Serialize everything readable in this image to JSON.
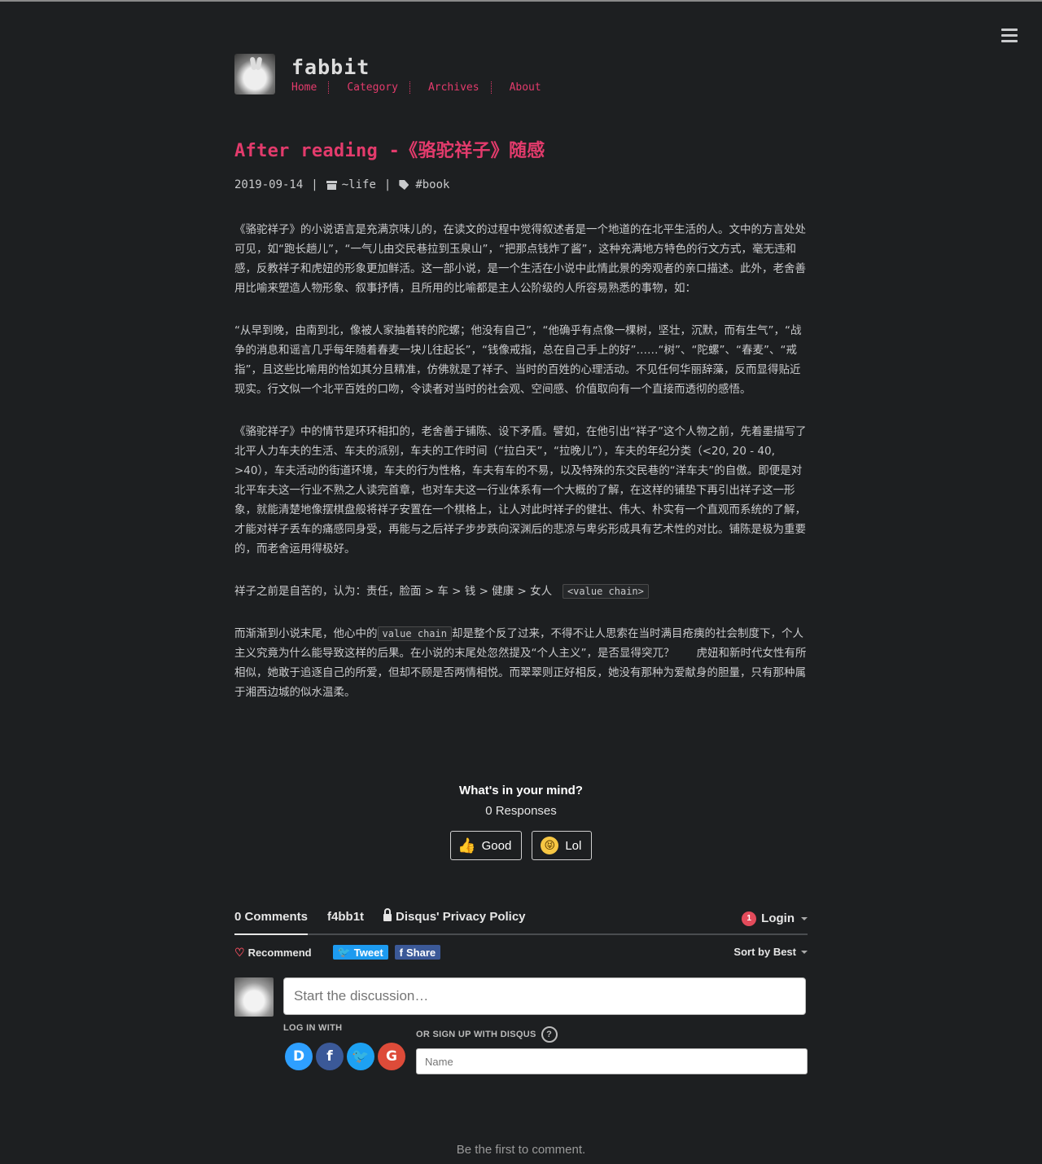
{
  "site": {
    "title": "fabbit",
    "nav": [
      "Home",
      "Category",
      "Archives",
      "About"
    ]
  },
  "post": {
    "title": "After reading -《骆驼祥子》随感",
    "date": "2019-09-14",
    "sep": "|",
    "category": "~life",
    "tag": "#book",
    "paragraphs": [
      "《骆驼祥子》的小说语言是充满京味儿的，在读文的过程中觉得叙述者是一个地道的在北平生活的人。文中的方言处处可见，如“跑长趟儿”，“一气儿由交民巷拉到玉泉山”，“把那点钱炸了酱”，这种充满地方特色的行文方式，毫无违和感，反教祥子和虎妞的形象更加鲜活。这一部小说，是一个生活在小说中此情此景的旁观者的亲口描述。此外，老舍善用比喻来塑造人物形象、叙事抒情，且所用的比喻都是主人公阶级的人所容易熟悉的事物，如：",
      "“从早到晚，由南到北，像被人家抽着转的陀螺；他没有自己”，“他确乎有点像一棵树，坚壮，沉默，而有生气”，“战争的消息和谣言几乎每年随着春麦一块儿往起长”，“钱像戒指，总在自己手上的好”……“树”、“陀螺”、“春麦”、“戒指”，且这些比喻用的恰如其分且精准，仿佛就是了祥子、当时的百姓的心理活动。不见任何华丽辞藻，反而显得贴近现实。行文似一个北平百姓的口吻，令读者对当时的社会观、空间感、价值取向有一个直接而透彻的感悟。",
      "《骆驼祥子》中的情节是环环相扣的，老舍善于铺陈、设下矛盾。譬如，在他引出“祥子”这个人物之前，先着墨描写了北平人力车夫的生活、车夫的派别，车夫的工作时间（“拉白天”，“拉晚儿”），车夫的年纪分类（<20, 20 - 40, >40），车夫活动的街道环境，车夫的行为性格，车夫有车的不易，以及特殊的东交民巷的“洋车夫”的自傲。即便是对北平车夫这一行业不熟之人读完首章，也对车夫这一行业体系有一个大概的了解，在这样的铺垫下再引出祥子这一形象，就能清楚地像摆棋盘般将祥子安置在一个棋格上，让人对此时祥子的健壮、伟大、朴实有一个直观而系统的了解，才能对祥子丢车的痛感同身受，再能与之后祥子步步跌向深渊后的悲凉与卑劣形成具有艺术性的对比。铺陈是极为重要的，而老舍运用得极好。"
    ],
    "value_line": "祥子之前是自苦的，认为：责任，脸面 > 车 > 钱 > 健康 > 女人",
    "value_code": "<value chain>",
    "last_pre": "而渐渐到小说末尾，他心中的",
    "last_code": "value chain",
    "last_post": "却是整个反了过来，不得不让人思索在当时满目疮痍的社会制度下，个人主义究竟为什么能导致这样的后果。在小说的末尾处忽然提及“个人主义”，是否显得突兀？　　虎妞和新时代女性有所相似，她敢于追逐自己的所爱，但却不顾是否两情相悦。而翠翠则正好相反，她没有那种为爱献身的胆量，只有那种属于湘西边城的似水温柔。"
  },
  "reactions": {
    "question": "What's in your mind?",
    "count": "0 Responses",
    "buttons": [
      {
        "label": "Good",
        "icon": "thumbs-up-icon"
      },
      {
        "label": "Lol",
        "icon": "laughing-face-icon"
      }
    ]
  },
  "disqus": {
    "tabs": [
      "0 Comments",
      "f4bb1t",
      "Disqus' Privacy Policy"
    ],
    "login_badge": "1",
    "login": "Login",
    "recommend": "Recommend",
    "tweet": "Tweet",
    "share": "Share",
    "sort": "Sort by Best",
    "placeholder": "Start the discussion…",
    "log_in_with": "LOG IN WITH",
    "signup": "OR SIGN UP WITH DISQUS",
    "help": "?",
    "providers": [
      {
        "letter": "D",
        "icon": "disqus-icon"
      },
      {
        "letter": "f",
        "icon": "facebook-icon"
      },
      {
        "letter": "🐦",
        "icon": "twitter-icon"
      },
      {
        "letter": "G",
        "icon": "google-icon"
      }
    ],
    "name_placeholder": "Name",
    "first": "Be the first to comment."
  },
  "colors": {
    "accent": "#e33b6c",
    "background": "#1d1f21",
    "text": "#c9cacc"
  }
}
